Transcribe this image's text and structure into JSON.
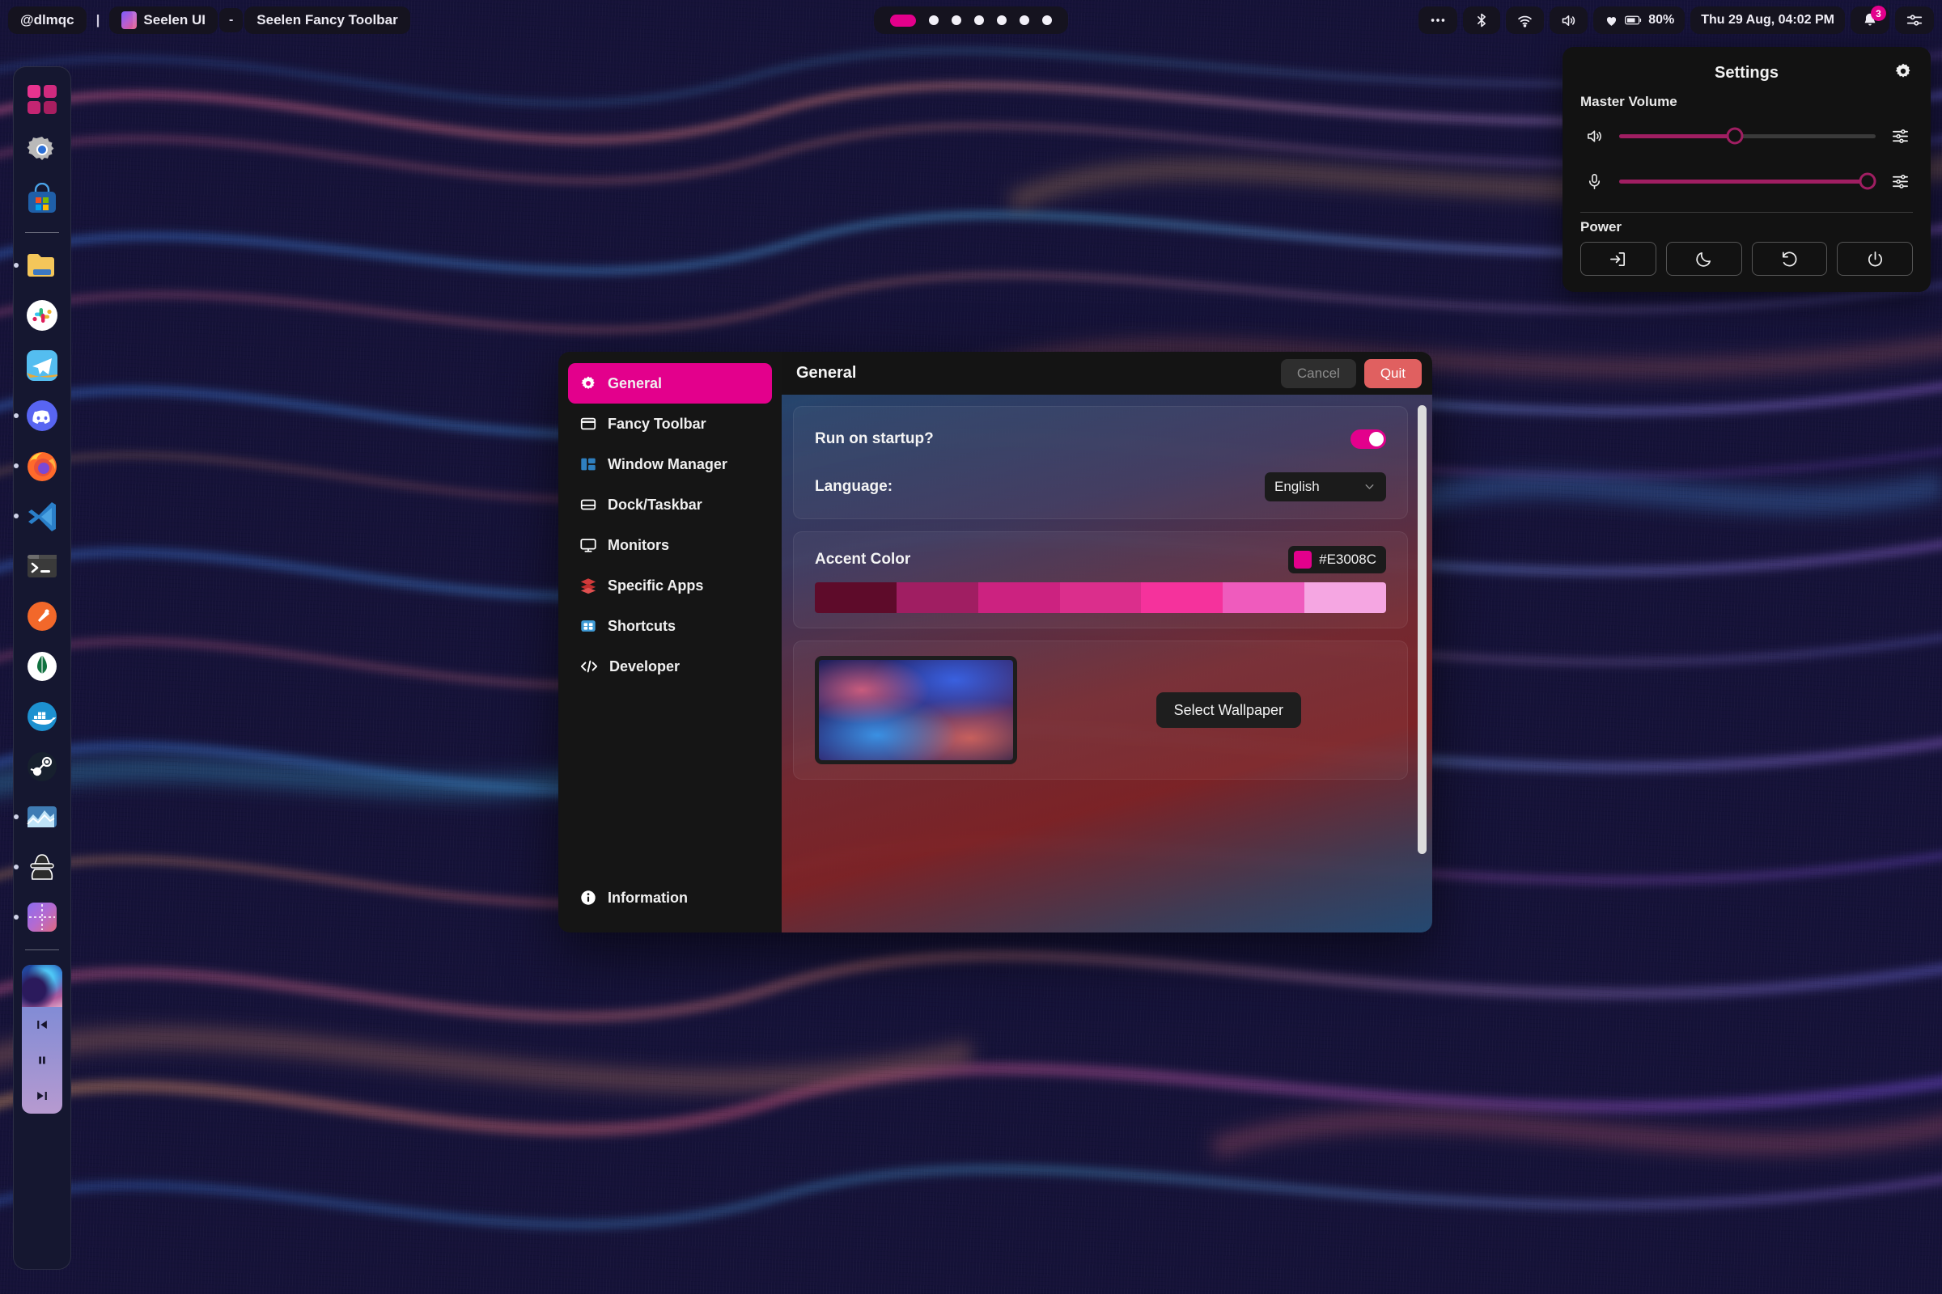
{
  "topbar": {
    "user": "@dlmqc",
    "separator": "|",
    "app_name": "Seelen UI",
    "dash": "-",
    "window_title": "Seelen Fancy Toolbar",
    "app_icon": "seelen-logo-icon",
    "workspaces": {
      "count": 7,
      "active_index": 0
    },
    "tray": [
      {
        "name": "overflow-icon",
        "label": "•••"
      },
      {
        "name": "bluetooth-icon",
        "label": ""
      },
      {
        "name": "wifi-icon",
        "label": ""
      },
      {
        "name": "volume-icon",
        "label": ""
      }
    ],
    "battery": {
      "icon": "battery-icon",
      "heart_icon": "heart-icon",
      "percent": "80%"
    },
    "clock": "Thu 29 Aug, 04:02 PM",
    "notifications": {
      "icon": "bell-icon",
      "count": "3"
    },
    "quick_settings_icon": "sliders-icon"
  },
  "dock": {
    "items": [
      {
        "name": "start-menu-icon",
        "active": false
      },
      {
        "name": "settings-gear-icon",
        "active": false
      },
      {
        "name": "microsoft-store-icon",
        "active": false
      },
      {
        "name": "divider",
        "active": false
      },
      {
        "name": "file-explorer-icon",
        "active": true
      },
      {
        "name": "slack-icon",
        "active": false
      },
      {
        "name": "telegram-icon",
        "active": false
      },
      {
        "name": "discord-icon",
        "active": true
      },
      {
        "name": "firefox-icon",
        "active": true
      },
      {
        "name": "vscode-icon",
        "active": true
      },
      {
        "name": "terminal-icon",
        "active": false
      },
      {
        "name": "postman-icon",
        "active": false
      },
      {
        "name": "mongodb-icon",
        "active": false
      },
      {
        "name": "docker-icon",
        "active": false
      },
      {
        "name": "steam-icon",
        "active": false
      },
      {
        "name": "grafana-icon",
        "active": true
      },
      {
        "name": "incognito-icon",
        "active": true
      },
      {
        "name": "seelen-icon",
        "active": true
      },
      {
        "name": "divider",
        "active": false
      }
    ],
    "media_player": {
      "prev_icon": "previous-track-icon",
      "play_icon": "pause-icon",
      "next_icon": "next-track-icon"
    }
  },
  "flyout": {
    "title": "Settings",
    "gear_icon": "gear-icon",
    "volume_section_label": "Master Volume",
    "sliders": [
      {
        "name": "speaker",
        "icon": "speaker-icon",
        "value": 45,
        "eq_icon": "equalizer-icon"
      },
      {
        "name": "mic",
        "icon": "microphone-icon",
        "value": 96,
        "eq_icon": "equalizer-icon"
      }
    ],
    "power_section_label": "Power",
    "power_buttons": [
      {
        "name": "sign-out-button",
        "icon": "sign-out-icon"
      },
      {
        "name": "sleep-button",
        "icon": "moon-icon"
      },
      {
        "name": "restart-button",
        "icon": "restart-icon"
      },
      {
        "name": "shutdown-button",
        "icon": "power-icon"
      }
    ]
  },
  "dialog": {
    "sidebar": [
      {
        "label": "General",
        "icon": "gear-icon",
        "active": true
      },
      {
        "label": "Fancy Toolbar",
        "icon": "toolbar-icon",
        "active": false
      },
      {
        "label": "Window Manager",
        "icon": "window-manager-icon",
        "active": false
      },
      {
        "label": "Dock/Taskbar",
        "icon": "dock-icon",
        "active": false
      },
      {
        "label": "Monitors",
        "icon": "monitor-icon",
        "active": false
      },
      {
        "label": "Specific Apps",
        "icon": "layers-icon",
        "active": false
      },
      {
        "label": "Shortcuts",
        "icon": "keyboard-icon",
        "active": false
      },
      {
        "label": "Developer",
        "icon": "code-icon",
        "active": false
      }
    ],
    "sidebar_footer": {
      "label": "Information",
      "icon": "info-icon"
    },
    "header": {
      "title": "General",
      "cancel_label": "Cancel",
      "quit_label": "Quit"
    },
    "general": {
      "startup_label": "Run on startup?",
      "startup_enabled": true,
      "language_label": "Language:",
      "language_value": "English",
      "language_chevron": "chevron-down-icon",
      "accent_label": "Accent Color",
      "accent_value": "#E3008C",
      "accent_swatches": [
        "#5E0B2A",
        "#A01E62",
        "#CC2280",
        "#DB2E8C",
        "#F5329C",
        "#EF5BBD",
        "#F5A6E2"
      ],
      "wallpaper_button_label": "Select Wallpaper",
      "wallpaper_thumb_name": "wallpaper-preview"
    },
    "scrollbar_name": "content-scrollbar"
  }
}
